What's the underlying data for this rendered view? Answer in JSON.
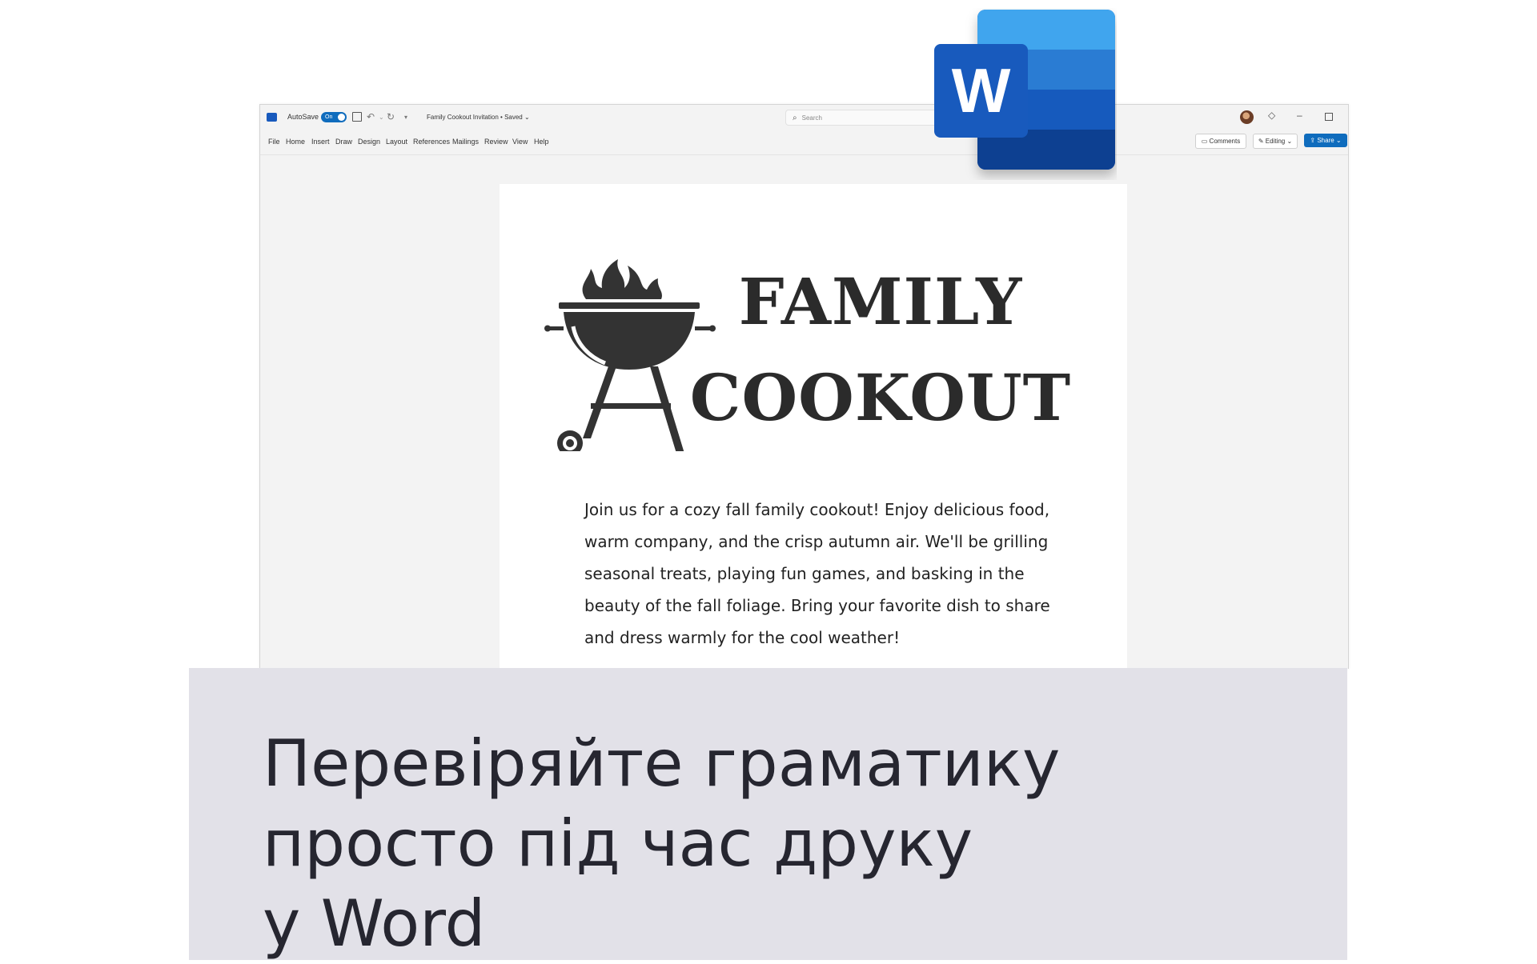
{
  "app": {
    "autosave_label": "AutoSave",
    "autosave_state": "On",
    "document_title": "Family Cookout Invitation • Saved ⌄",
    "search_placeholder": "Search"
  },
  "menu": {
    "tabs": [
      "File",
      "Home",
      "Insert",
      "Draw",
      "Design",
      "Layout",
      "References",
      "Mailings",
      "Review",
      "View",
      "Help"
    ]
  },
  "ribbon": {
    "comments_label": "Comments",
    "editing_label": "Editing ⌄",
    "share_label": "Share ⌄"
  },
  "document": {
    "title_line1": "FAMILY",
    "title_line2": "COOKOUT",
    "body": "Join us for a cozy fall family cookout! Enjoy delicious food, warm company, and the crisp autumn air. We'll be grilling seasonal treats, playing fun games, and basking in the beauty of the fall foliage. Bring your favorite dish to share and dress warmly for the cool weather!"
  },
  "logo": {
    "letter": "W"
  },
  "caption": {
    "line1": "Перевіряйте граматику",
    "line2": "просто під час друку",
    "line3": "у Word"
  },
  "colors": {
    "word_blue": "#185abd",
    "share_blue": "#0f6cbd",
    "caption_bg": "#e2e1e8"
  }
}
